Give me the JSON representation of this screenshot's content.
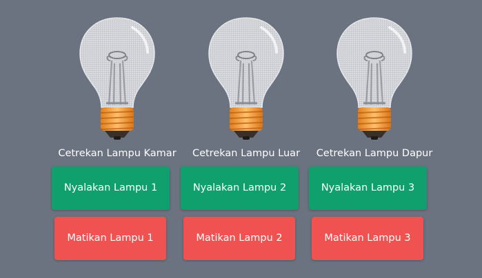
{
  "colors": {
    "background": "#6b7280",
    "on_button": "#10a06e",
    "off_button": "#f05252",
    "glass": "#d4d6db",
    "base": "#f29a3a"
  },
  "lamps": [
    {
      "caption": "Cetrekan Lampu Kamar",
      "on_label": "Nyalakan Lampu 1",
      "off_label": "Matikan Lampu 1",
      "icon": "lightbulb-icon"
    },
    {
      "caption": "Cetrekan Lampu Luar",
      "on_label": "Nyalakan Lampu 2",
      "off_label": "Matikan Lampu 2",
      "icon": "lightbulb-icon"
    },
    {
      "caption": "Cetrekan Lampu Dapur",
      "on_label": "Nyalakan Lampu 3",
      "off_label": "Matikan Lampu 3",
      "icon": "lightbulb-icon"
    }
  ]
}
